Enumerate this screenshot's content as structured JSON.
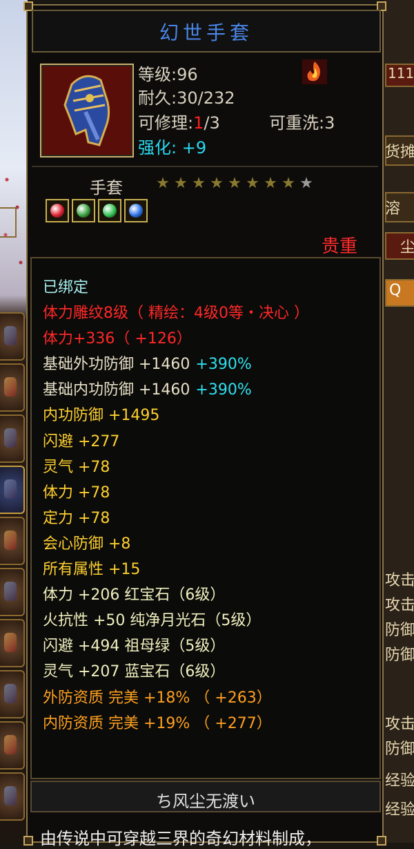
{
  "item": {
    "name": "幻世手套",
    "level_label": "等级",
    "level_value": "96",
    "durability_label": "耐久",
    "durability_value": "30/232",
    "repair_label": "可修理",
    "repair_used": "1",
    "repair_total": "/3",
    "reroll_label": "可重洗",
    "reroll_value": "3",
    "enhance_label": "强化",
    "enhance_value": "+9",
    "type": "手套",
    "stars_total": 9,
    "stars_filled": 8,
    "rarity": "贵重",
    "gem_colors": [
      "#e02030",
      "#38a040",
      "#30c050",
      "#2a70e8"
    ]
  },
  "attributes": [
    {
      "text": "已绑定",
      "color": "cyan"
    },
    {
      "text": "体力雕纹8级（ 精绘：4级0等・决心 ）",
      "color": "red"
    },
    {
      "text": "体力+336（ +126）",
      "color": "red"
    },
    {
      "text": "基础外功防御  +1460",
      "extra": "+390%",
      "color": "white"
    },
    {
      "text": "基础内功防御  +1460",
      "extra": "+390%",
      "color": "white"
    },
    {
      "text": "内功防御  +1495",
      "color": "yellow"
    },
    {
      "text": "闪避  +277",
      "color": "yellow"
    },
    {
      "text": "灵气  +78",
      "color": "yellow"
    },
    {
      "text": "体力  +78",
      "color": "yellow"
    },
    {
      "text": "定力  +78",
      "color": "yellow"
    },
    {
      "text": "会心防御  +8",
      "color": "yellow"
    },
    {
      "text": "所有属性  +15",
      "color": "yellow"
    },
    {
      "text": "体力  +206  红宝石（6级）",
      "color": "gem"
    },
    {
      "text": "火抗性  +50  纯净月光石（5级）",
      "color": "gem"
    },
    {
      "text": "闪避  +494  祖母绿（5级）",
      "color": "gem"
    },
    {
      "text": "灵气  +207  蓝宝石（6级）",
      "color": "gem"
    },
    {
      "text": "外防资质    完美   +18% （ +263）",
      "color": "orange"
    },
    {
      "text": "内防资质    完美   +19% （ +277）",
      "color": "orange"
    }
  ],
  "signature": "ち风尘无渡い",
  "description": "由传说中可穿越三界的奇幻材料制成，",
  "right_panel": {
    "texts": [
      "111",
      "货摊",
      "溶",
      "尘",
      "Q",
      "攻击",
      "攻击",
      "防御",
      "防御",
      "攻击",
      "防御",
      "经验",
      "经验"
    ]
  }
}
